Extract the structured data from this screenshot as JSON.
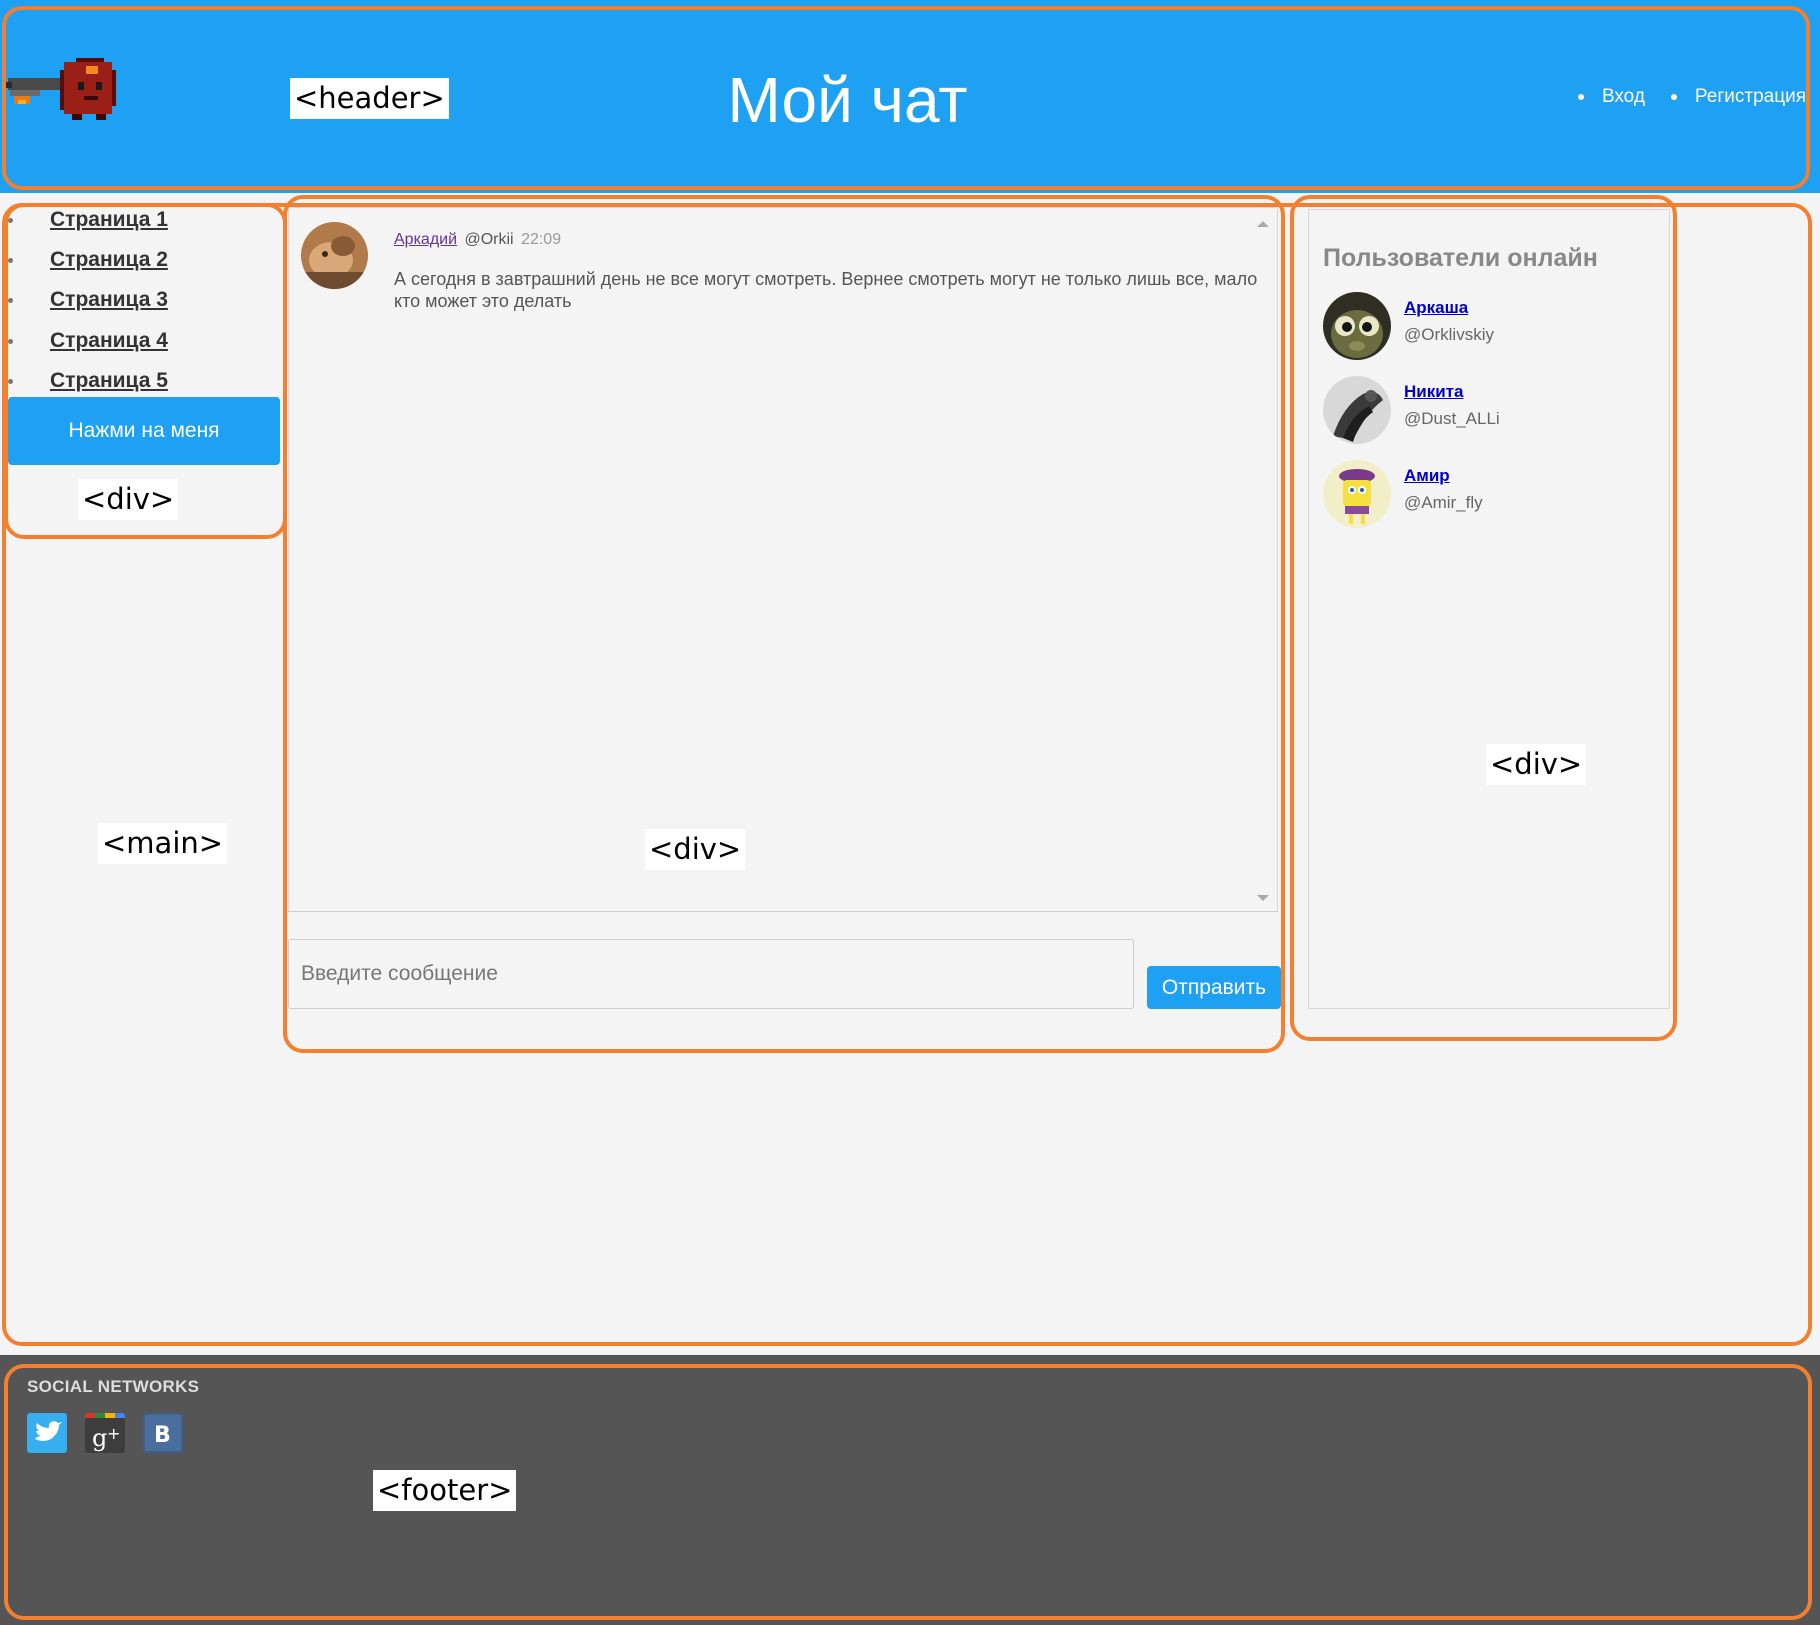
{
  "header": {
    "title": "Мой чат",
    "nav": [
      {
        "label": "Вход"
      },
      {
        "label": "Регистрация"
      }
    ]
  },
  "sidebar": {
    "pages": [
      {
        "label": "Страница 1"
      },
      {
        "label": "Страница 2"
      },
      {
        "label": "Страница 3"
      },
      {
        "label": "Страница 4"
      },
      {
        "label": "Страница 5"
      }
    ],
    "button_label": "Нажми на меня"
  },
  "chat": {
    "messages": [
      {
        "author": "Аркадий",
        "handle": "@Orkii",
        "time": "22:09",
        "text": "А сегодня в завтрашний день не все могут смотреть. Вернее смотреть могут не только лишь все, мало кто может это делать"
      }
    ],
    "input_placeholder": "Введите сообщение",
    "send_label": "Отправить"
  },
  "online": {
    "title": "Пользователи онлайн",
    "users": [
      {
        "name": "Аркаша",
        "handle": "@Orklivskiy"
      },
      {
        "name": "Никита",
        "handle": "@Dust_ALLi"
      },
      {
        "name": "Амир",
        "handle": "@Amir_fly"
      }
    ]
  },
  "footer": {
    "title": "SOCIAL NETWORKS",
    "networks": [
      "twitter-icon",
      "google-plus-icon",
      "vk-icon"
    ]
  },
  "annotations": {
    "header": "<header>",
    "sidebar": "<div>",
    "main": "<main>",
    "chat": "<div>",
    "online": "<div>",
    "footer": "<footer>"
  },
  "colors": {
    "accent": "#1ea1f2",
    "outline": "#f47f2f",
    "footer_bg": "#555555",
    "page_bg": "#f4f4f4"
  }
}
